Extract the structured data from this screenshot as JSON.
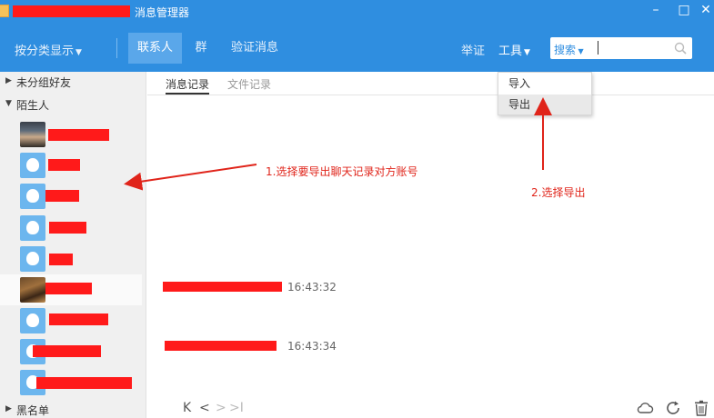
{
  "window": {
    "title": "消息管理器",
    "controls": {
      "minimize": "–",
      "maximize": "□",
      "close": "✕"
    }
  },
  "nav": {
    "sort_label": "按分类显示",
    "tabs": [
      {
        "label": "联系人"
      },
      {
        "label": "群"
      },
      {
        "label": "验证消息"
      }
    ],
    "report": "举证",
    "tools": "工具",
    "search_label": "搜索",
    "search_value": ""
  },
  "sidebar": {
    "groups": [
      {
        "label": "未分组好友",
        "expanded": false
      },
      {
        "label": "陌生人",
        "expanded": true
      },
      {
        "label": "黑名单",
        "expanded": false
      }
    ]
  },
  "main": {
    "subtabs": [
      {
        "label": "消息记录"
      },
      {
        "label": "文件记录"
      }
    ],
    "messages": [
      {
        "time": "16:43:32"
      },
      {
        "time": "16:43:34"
      }
    ]
  },
  "dropdown": {
    "items": [
      {
        "label": "导入"
      },
      {
        "label": "导出"
      }
    ]
  },
  "annotations": {
    "step1": "1.选择要导出聊天记录对方账号",
    "step2": "2.选择导出",
    "color": "#e0241a"
  },
  "colors": {
    "primary": "#2f8ee0",
    "active_tab": "#5aa7ea",
    "redaction": "#ff1a1a"
  },
  "pager": {
    "first": "K",
    "prev": "<",
    "next": ">",
    "last": ">I"
  }
}
